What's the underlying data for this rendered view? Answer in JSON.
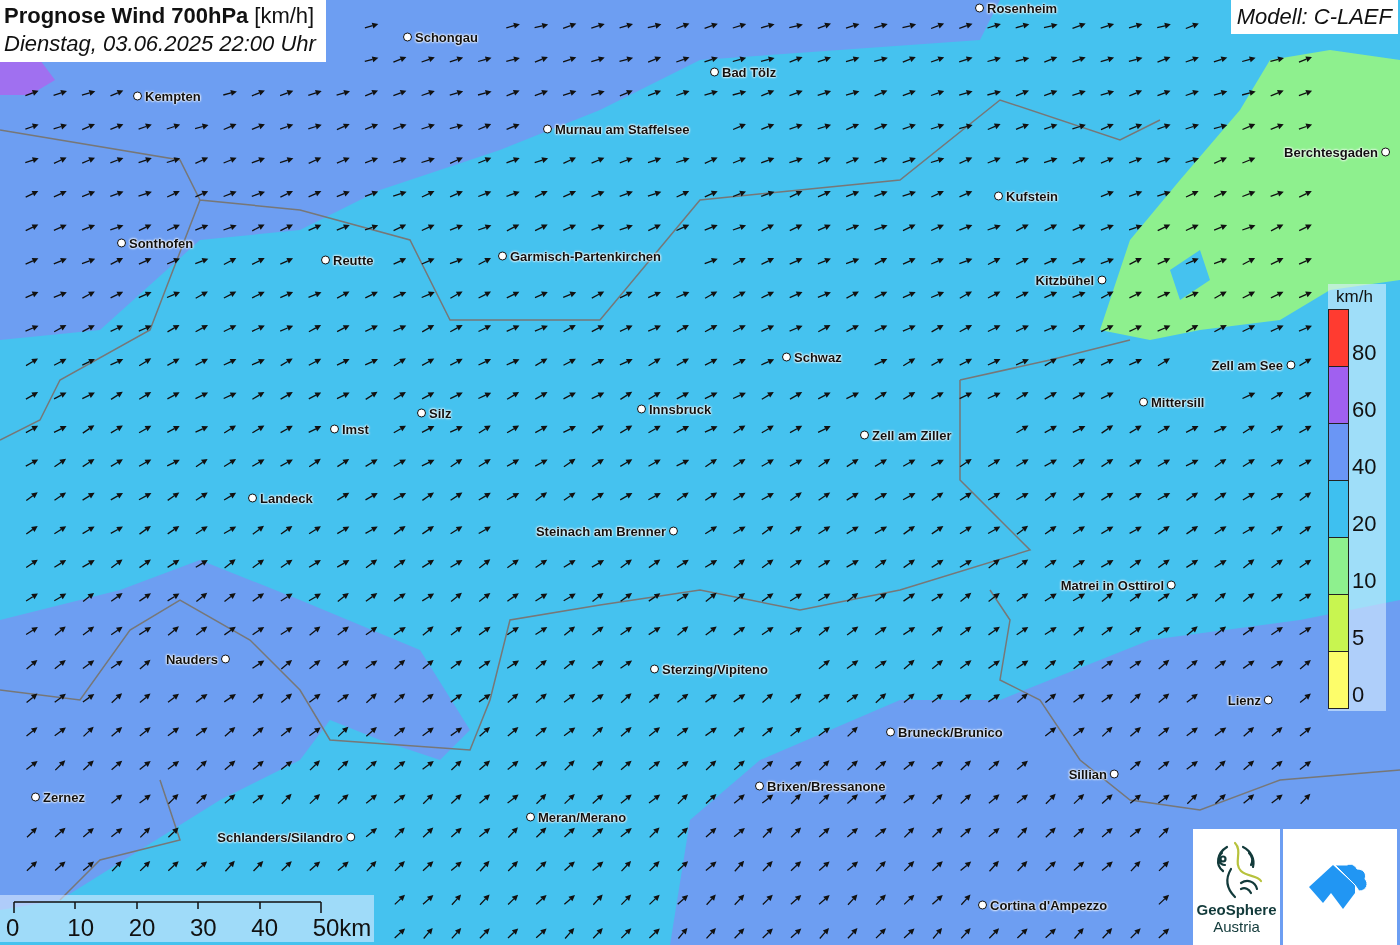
{
  "title": {
    "heading": "Prognose Wind 700hPa",
    "unit": "[km/h]",
    "subtitle": "Dienstag, 03.06.2025 22:00 Uhr"
  },
  "model": "Modell: C-LAEF",
  "cities": [
    "Rosenheim",
    "Schongau",
    "Bad Tölz",
    "Kempten",
    "Murnau am Staffelsee",
    "Berchtesgaden",
    "Kufstein",
    "Sonthofen",
    "Reutte",
    "Garmisch-Partenkirchen",
    "Kitzbühel",
    "Schwaz",
    "Zell am See",
    "Mittersill",
    "Silz",
    "Innsbruck",
    "Imst",
    "Zell am Ziller",
    "Landeck",
    "Steinach am Brenner",
    "Matrei in Osttirol",
    "Nauders",
    "Sterzing/Vipiteno",
    "Lienz",
    "Bruneck/Brunico",
    "Sillian",
    "Brixen/Bressanone",
    "Zernez",
    "Meran/Merano",
    "Schlanders/Silandro",
    "Cortina d'Ampezzo"
  ],
  "legend": {
    "unit": "km/h",
    "bands": [
      {
        "label": "80",
        "color": "#ff3b30"
      },
      {
        "label": "60",
        "color": "#a060f0"
      },
      {
        "label": "40",
        "color": "#6a96f5"
      },
      {
        "label": "20",
        "color": "#3ec0f0"
      },
      {
        "label": "10",
        "color": "#8ef08e"
      },
      {
        "label": "5",
        "color": "#c8f550"
      },
      {
        "label": "0",
        "color": "#fdfd6a"
      }
    ]
  },
  "scale": {
    "ticks": [
      "0",
      "10",
      "20",
      "30",
      "40",
      "50km"
    ]
  },
  "logo": {
    "name": "GeoSphere",
    "country": "Austria"
  }
}
